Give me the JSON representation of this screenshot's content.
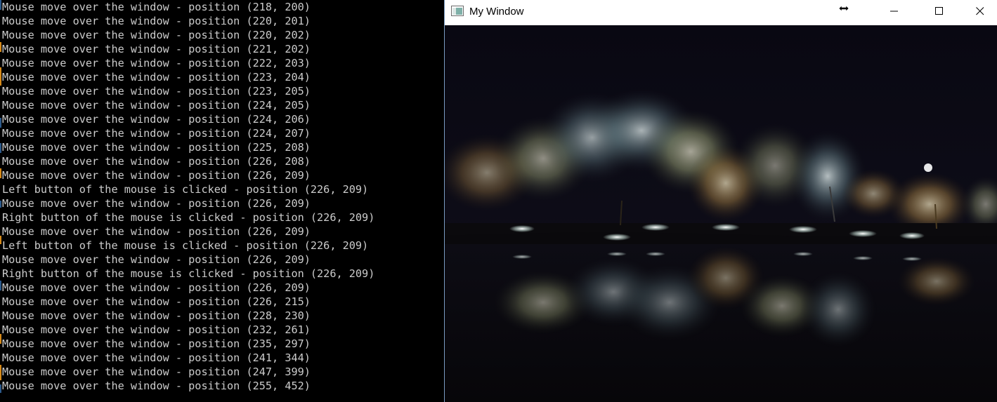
{
  "console": {
    "lines": [
      "Mouse move over the window - position (218, 200)",
      "Mouse move over the window - position (220, 201)",
      "Mouse move over the window - position (220, 202)",
      "Mouse move over the window - position (221, 202)",
      "Mouse move over the window - position (222, 203)",
      "Mouse move over the window - position (223, 204)",
      "Mouse move over the window - position (223, 205)",
      "Mouse move over the window - position (224, 205)",
      "Mouse move over the window - position (224, 206)",
      "Mouse move over the window - position (224, 207)",
      "Mouse move over the window - position (225, 208)",
      "Mouse move over the window - position (226, 208)",
      "Mouse move over the window - position (226, 209)",
      "Left button of the mouse is clicked - position (226, 209)",
      "Mouse move over the window - position (226, 209)",
      "Right button of the mouse is clicked - position (226, 209)",
      "Mouse move over the window - position (226, 209)",
      "Left button of the mouse is clicked - position (226, 209)",
      "Mouse move over the window - position (226, 209)",
      "Right button of the mouse is clicked - position (226, 209)",
      "Mouse move over the window - position (226, 209)",
      "Mouse move over the window - position (226, 215)",
      "Mouse move over the window - position (228, 230)",
      "Mouse move over the window - position (232, 261)",
      "Mouse move over the window - position (235, 297)",
      "Mouse move over the window - position (241, 344)",
      "Mouse move over the window - position (247, 399)",
      "Mouse move over the window - position (255, 452)"
    ],
    "text_color": "#cccccc",
    "background": "#000000"
  },
  "window": {
    "title": "My Window",
    "icons": {
      "app": "opencv-window-icon",
      "cursor": "horizontal-resize-cursor-icon",
      "minimize": "minimize-icon",
      "maximize": "maximize-icon",
      "close": "close-icon"
    },
    "image": {
      "subject": "night-garden-lake-reflection"
    }
  }
}
